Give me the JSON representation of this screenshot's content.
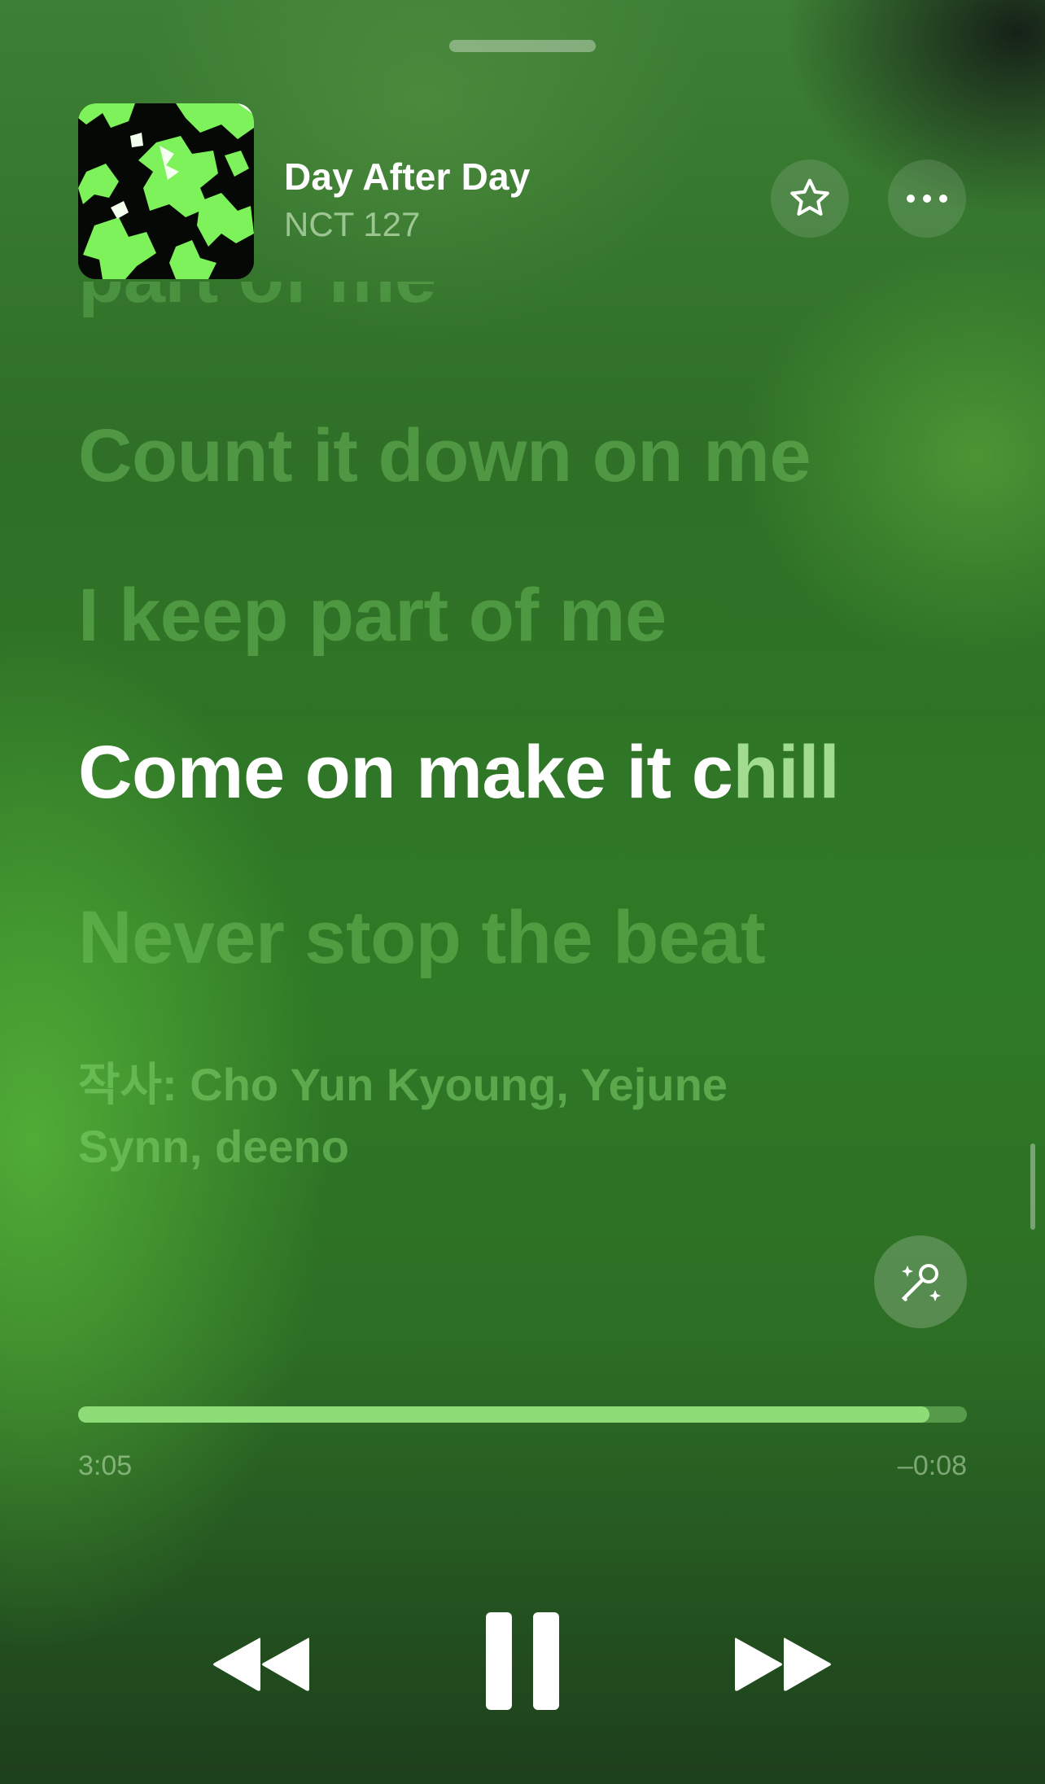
{
  "now_playing": {
    "title": "Day After Day",
    "artist": "NCT 127"
  },
  "lyrics": {
    "previous_partial": "part of me",
    "lines": [
      {
        "text": "Count it down on me",
        "state": "past"
      },
      {
        "text": "I keep part of me",
        "state": "past"
      },
      {
        "text_sung": "Come on make it c",
        "text_unsung": "hill",
        "state": "current"
      },
      {
        "text": "Never stop the beat",
        "state": "upcoming"
      }
    ],
    "credits": "작사: Cho Yun Kyoung, Yejune Synn, deeno"
  },
  "playback": {
    "elapsed": "3:05",
    "remaining": "–0:08",
    "progress_fraction": 0.958
  },
  "icons": {
    "favorite": "star-icon",
    "more": "ellipsis-icon",
    "sing": "microphone-sparkle-icon",
    "rewind": "rewind-icon",
    "pause": "pause-icon",
    "forward": "fast-forward-icon"
  },
  "colors": {
    "accent": "#8edc78",
    "art_green": "#7df25a"
  }
}
